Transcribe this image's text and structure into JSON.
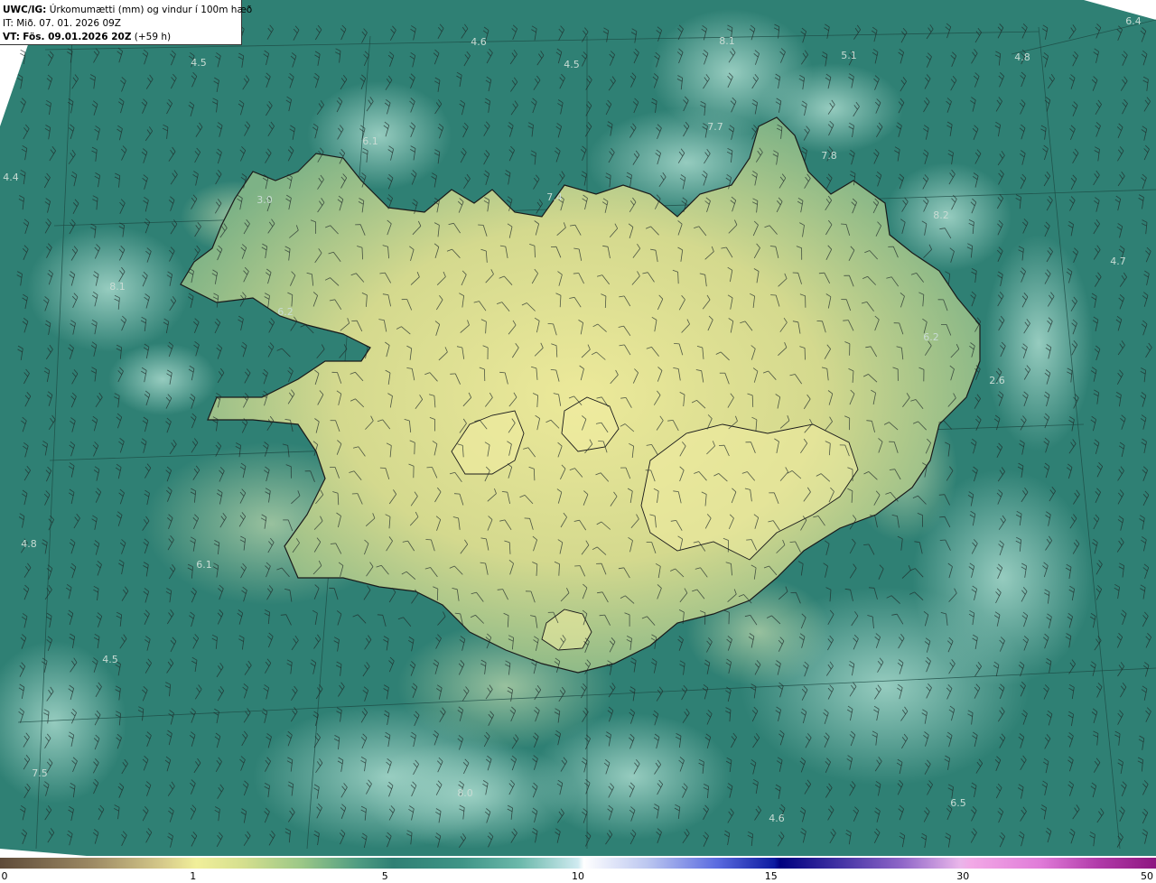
{
  "header": {
    "model": "UWC/IG:",
    "description": "Úrkomumætti (mm) og vindur í 100m hæð",
    "initial_time": "IT: Mið. 07. 01. 2026 09Z",
    "valid_prefix": "VT:",
    "valid_time": "Fös. 09.01.2026 20Z",
    "lead_time": "(+59 h)"
  },
  "map_labels": [
    {
      "text": "6.4"
    },
    {
      "text": "4.5"
    },
    {
      "text": "4.6"
    },
    {
      "text": "8.1"
    },
    {
      "text": "4.5"
    },
    {
      "text": "5.1"
    },
    {
      "text": "4.8"
    },
    {
      "text": "6.1"
    },
    {
      "text": "7.7"
    },
    {
      "text": "7.8"
    },
    {
      "text": "4.4"
    },
    {
      "text": "3.0"
    },
    {
      "text": "7.4"
    },
    {
      "text": "8.2"
    },
    {
      "text": "4.7"
    },
    {
      "text": "8.1"
    },
    {
      "text": "6.2"
    },
    {
      "text": "2.6"
    },
    {
      "text": "6.2"
    },
    {
      "text": "4.8"
    },
    {
      "text": "6.1"
    },
    {
      "text": "4.5"
    },
    {
      "text": "6.5"
    },
    {
      "text": "4.6"
    },
    {
      "text": "7.5"
    },
    {
      "text": "8.0"
    }
  ],
  "legend": {
    "ticks": [
      {
        "label": "0",
        "pos": 0.0
      },
      {
        "label": "1",
        "pos": 0.167
      },
      {
        "label": "5",
        "pos": 0.333
      },
      {
        "label": "10",
        "pos": 0.5
      },
      {
        "label": "15",
        "pos": 0.667
      },
      {
        "label": "30",
        "pos": 0.833
      },
      {
        "label": "50",
        "pos": 1.0
      }
    ]
  },
  "colors": {
    "ocean": "#2f8074",
    "land_low": "#6fae86",
    "land_high": "#e9e596",
    "coast": "#1a1a1a",
    "wind_barb": "#1f2a28",
    "label": "#c9dcd4"
  },
  "layers": {
    "wind_barbs": "wind-barb-icon",
    "grid": "lat-lon-grid"
  }
}
